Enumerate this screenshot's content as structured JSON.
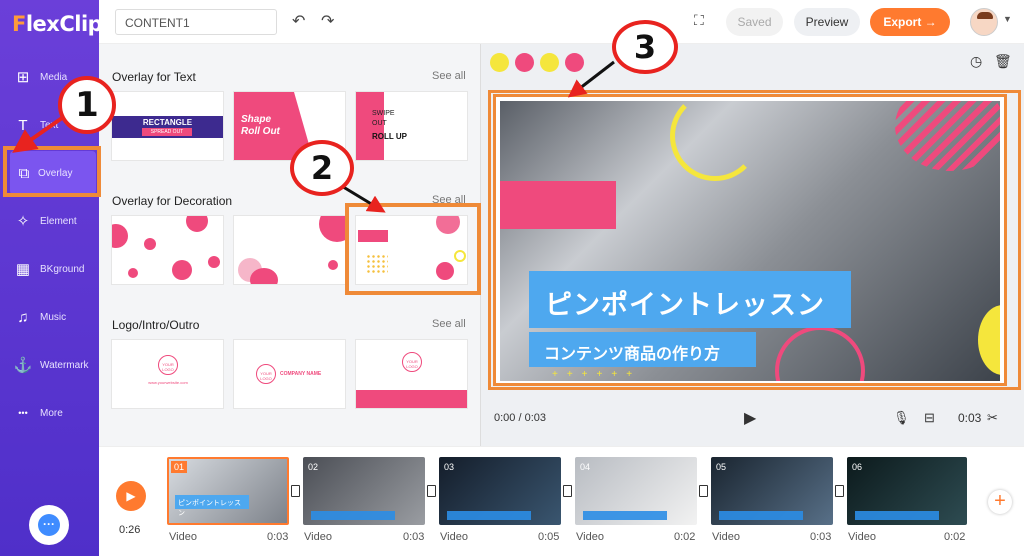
{
  "app": {
    "logo": "lexClip",
    "logo_f": "F"
  },
  "sidebar": {
    "items": [
      {
        "label": "Media",
        "icon": "media-icon",
        "glyph": "⊞"
      },
      {
        "label": "Text",
        "icon": "text-icon",
        "glyph": "T"
      },
      {
        "label": "Overlay",
        "icon": "overlay-icon",
        "glyph": "⧉"
      },
      {
        "label": "Element",
        "icon": "element-icon",
        "glyph": "✧"
      },
      {
        "label": "BKground",
        "icon": "background-icon",
        "glyph": "▦"
      },
      {
        "label": "Music",
        "icon": "music-icon",
        "glyph": "♫"
      },
      {
        "label": "Watermark",
        "icon": "watermark-icon",
        "glyph": "⚓"
      },
      {
        "label": "More",
        "icon": "more-icon",
        "glyph": "•••"
      }
    ],
    "active": "Overlay"
  },
  "topbar": {
    "project_name": "CONTENT1",
    "saved_label": "Saved",
    "preview_label": "Preview",
    "export_label": "Export →"
  },
  "panel": {
    "sections": [
      {
        "title": "Overlay for Text",
        "see_all": "See all",
        "thumbs": [
          {
            "line1": "RECTANGLE",
            "line2": "SPREAD OUT"
          },
          {
            "line1": "Shape",
            "line2": "Roll Out"
          },
          {
            "line1": "SWIPE",
            "line2": "OUT",
            "line3": "ROLL UP"
          }
        ]
      },
      {
        "title": "Overlay for Decoration",
        "see_all": "See all"
      },
      {
        "title": "Logo/Intro/Outro",
        "see_all": "See all",
        "thumbs": [
          {
            "line1": "YOUR",
            "line2": "LOGO",
            "line3": "www.yourwebsite.com"
          },
          {
            "line1": "YOUR",
            "line2": "LOGO",
            "line3": "COMPANY NAME"
          },
          {
            "line1": "YOUR",
            "line2": "LOGO"
          }
        ]
      }
    ]
  },
  "stage": {
    "color_dots": [
      "#f5e63c",
      "#ef4a7d",
      "#f5e63c",
      "#ef4a7d"
    ],
    "title_text": "ピンポイントレッスン",
    "subtitle_text": "コンテンツ商品の作り方",
    "time_display": "0:00 / 0:03",
    "duration": "0:03"
  },
  "timeline": {
    "total": "0:26",
    "clips": [
      {
        "num": "01",
        "label": "Video",
        "dur": "0:03"
      },
      {
        "num": "02",
        "label": "Video",
        "dur": "0:03"
      },
      {
        "num": "03",
        "label": "Video",
        "dur": "0:05"
      },
      {
        "num": "04",
        "label": "Video",
        "dur": "0:02"
      },
      {
        "num": "05",
        "label": "Video",
        "dur": "0:03"
      },
      {
        "num": "06",
        "label": "Video",
        "dur": "0:02"
      }
    ]
  },
  "annotations": {
    "m1": "1",
    "m2": "2",
    "m3": "3"
  },
  "colors": {
    "accent": "#ff7a2f",
    "sidebar": "#5a35d3",
    "highlight": "#ef8a38",
    "marker": "#e8231f",
    "pink": "#ef4a7d",
    "yellow": "#f5e63c",
    "blue": "#4ea8ef"
  }
}
